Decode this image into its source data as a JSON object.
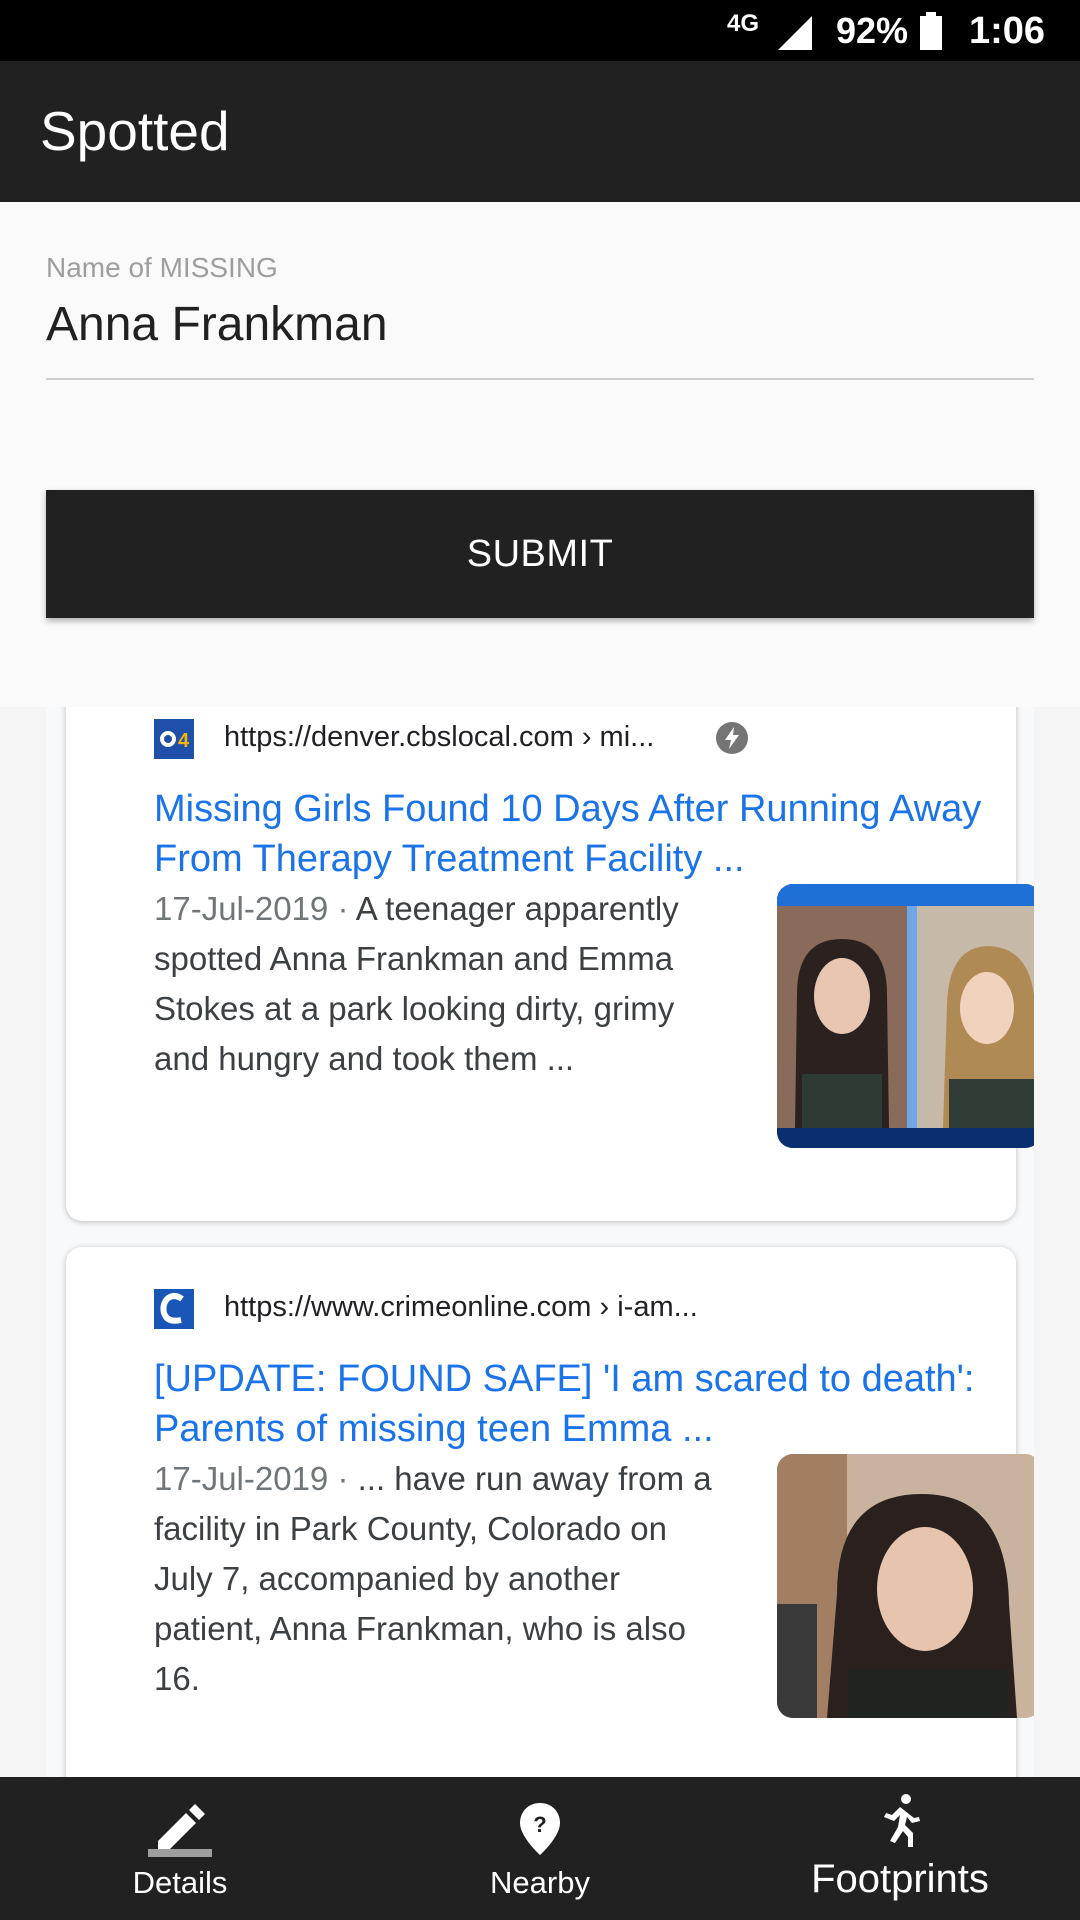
{
  "status_bar": {
    "network": "4G",
    "battery_percent": "92%",
    "time": "1:06"
  },
  "app_bar": {
    "title": "Spotted"
  },
  "form": {
    "name_label": "Name of MISSING",
    "name_value": "Anna Frankman",
    "submit_label": "SUBMIT"
  },
  "results": [
    {
      "favicon_text": "CBS4",
      "url": "https://denver.cbslocal.com › mi...",
      "title": "Missing Girls Found 10 Days After Running Away From Therapy Treatment Facility ...",
      "date": "17-Jul-2019",
      "separator": " · ",
      "snippet": "A teenager apparently spotted Anna Frankman and Emma Stokes at a park looking dirty, grimy and hungry and took them  ..."
    },
    {
      "favicon_text": "C",
      "url": "https://www.crimeonline.com › i-am...",
      "title": "[UPDATE: FOUND SAFE] 'I am scared to death': Parents of missing teen Emma ...",
      "date": "17-Jul-2019",
      "separator": " · ",
      "snippet": "... have run away from a facility in Park County, Colorado on July 7, accompanied by another patient, Anna Frankman, who is also 16."
    }
  ],
  "bottom_nav": {
    "items": [
      {
        "label": "Details",
        "icon": "pencil-icon"
      },
      {
        "label": "Nearby",
        "icon": "location-help-icon"
      },
      {
        "label": "Footprints",
        "icon": "runner-icon"
      }
    ],
    "active": "Footprints"
  },
  "colors": {
    "app_bar": "#212121",
    "status_bar": "#000000",
    "link": "#1a73e8",
    "submit": "#212121"
  }
}
